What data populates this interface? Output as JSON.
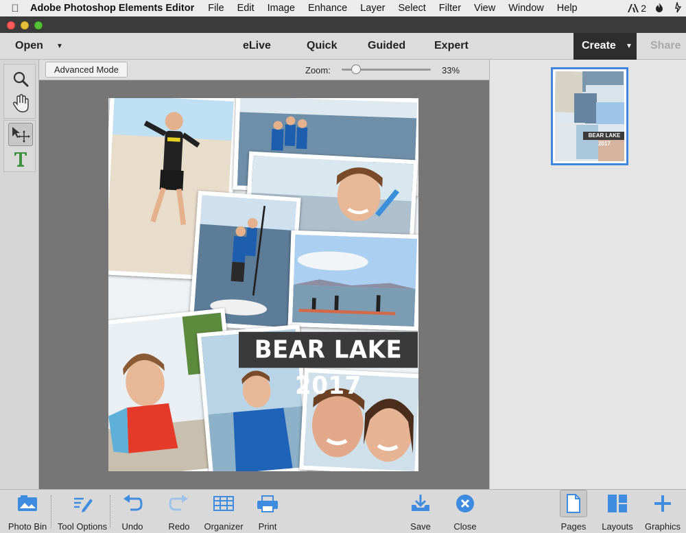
{
  "menubar": {
    "app_name": "Adobe Photoshop Elements Editor",
    "items": [
      "File",
      "Edit",
      "Image",
      "Enhance",
      "Layer",
      "Select",
      "Filter",
      "View",
      "Window",
      "Help"
    ],
    "status_badge": "2"
  },
  "modebar": {
    "open_label": "Open",
    "modes": [
      "eLive",
      "Quick",
      "Guided",
      "Expert"
    ],
    "create_label": "Create",
    "share_label": "Share"
  },
  "options": {
    "advanced_mode_label": "Advanced Mode",
    "zoom_label": "Zoom:",
    "zoom_value": "33%",
    "zoom_fraction": 0.12
  },
  "canvas": {
    "banner_text": "BEAR LAKE 2017"
  },
  "thumbnail": {
    "label": "BEAR LAKE 2017"
  },
  "bottombar": {
    "photo_bin": "Photo Bin",
    "tool_options": "Tool Options",
    "undo": "Undo",
    "redo": "Redo",
    "organizer": "Organizer",
    "print": "Print",
    "save": "Save",
    "close": "Close",
    "pages": "Pages",
    "layouts": "Layouts",
    "graphics": "Graphics"
  },
  "colors": {
    "accent_blue": "#3e86e0",
    "create_bg": "#2d2d2d",
    "canvas_bg": "#767676"
  }
}
